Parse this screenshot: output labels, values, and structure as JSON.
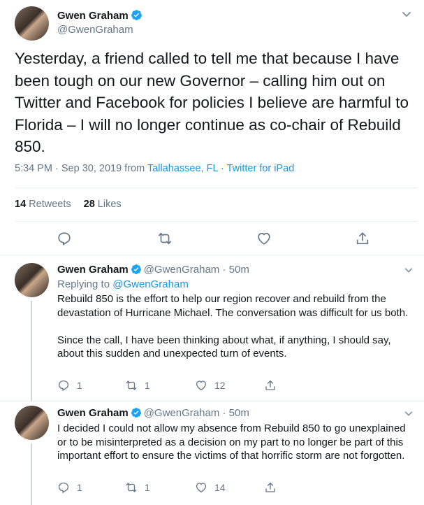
{
  "main_tweet": {
    "author_name": "Gwen Graham",
    "handle": "@GwenGraham",
    "text": "Yesterday, a friend called to tell me that because I have been tough on our new Governor – calling him out on Twitter and Facebook for policies I believe are harmful to Florida – I will no longer continue as co-chair of Rebuild 850.",
    "time": "5:34 PM · Sep 30, 2019 from ",
    "location": "Tallahassee, FL",
    "separator": " · ",
    "client": "Twitter for iPad",
    "retweets_count": "14",
    "retweets_label": "Retweets",
    "likes_count": "28",
    "likes_label": "Likes"
  },
  "replies": [
    {
      "author_name": "Gwen Graham",
      "handle": "@GwenGraham",
      "time": "· 50m",
      "replying_prefix": "Replying to ",
      "replying_to": "@GwenGraham",
      "text": "Rebuild 850 is the effort to help our region recover and rebuild from the devastation of Hurricane Michael. The conversation was difficult for us both.\n\nSince the call, I have been thinking about what, if anything, I should say, about this sudden and unexpected turn of events.",
      "reply_count": "1",
      "retweet_count": "1",
      "like_count": "12"
    },
    {
      "author_name": "Gwen Graham",
      "handle": "@GwenGraham",
      "time": "· 50m",
      "text": "I decided I could not allow my absence from Rebuild 850 to go unexplained or to be misinterpreted as a decision on my part to no longer be part of this important effort to ensure the victims of that horrific storm are not forgotten.",
      "reply_count": "1",
      "retweet_count": "1",
      "like_count": "14"
    }
  ],
  "icons": {
    "verified": "verified-badge-icon",
    "menu": "chevron-down-icon",
    "reply": "reply-bubble-icon",
    "retweet": "retweet-icon",
    "like": "heart-icon",
    "share": "share-icon"
  },
  "colors": {
    "link": "#1b95e0",
    "verified": "#1da1f2",
    "muted": "#657786"
  }
}
